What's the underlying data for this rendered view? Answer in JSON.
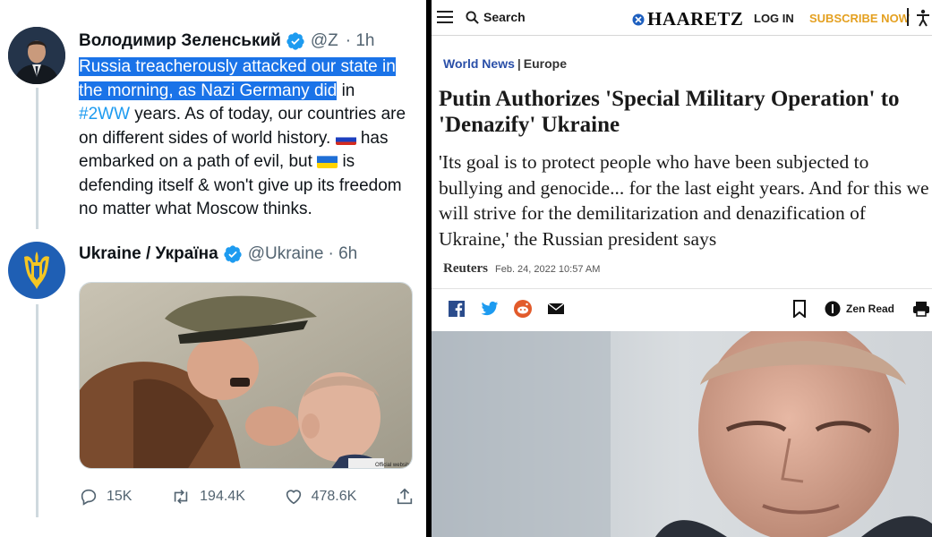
{
  "left": {
    "tweet1": {
      "name": "Володимир Зеленський",
      "handle": "@Z",
      "time": "· 1h",
      "text_highlight_1": "Russia treacherously attacked our state in",
      "text_highlight_2": "the morning, as Nazi Germany did",
      "text_after_highlight": " in",
      "hashtag": "#2WW",
      "text_2": " years. As of today, our countries are on different sides of world history. ",
      "text_3": " has embarked on a path of evil, but ",
      "text_4": " is defending itself & won't give up its freedom no matter what Moscow thinks."
    },
    "tweet2": {
      "name": "Ukraine / Україна",
      "handle": "@Ukraine",
      "time": "· 6h",
      "image_caption": "Official website",
      "replies": "15K",
      "retweets": "194.4K",
      "likes": "478.6K"
    },
    "colors": {
      "verified": "#1d9bf0",
      "highlight": "#1a73e8",
      "link": "#1d9bf0"
    }
  },
  "right": {
    "topbar": {
      "search_label": "Search",
      "logo": "HAARETZ",
      "login": "LOG IN",
      "subscribe": "SUBSCRIBE NOW"
    },
    "breadcrumb": {
      "section": "World News",
      "subsection": "Europe"
    },
    "headline": "Putin Authorizes 'Special Military Operation' to 'Denazify' Ukraine",
    "subhead": "'Its goal is to protect people who have been subjected to bullying and genocide... for the last eight years. And for this we will strive for the demilitarization and denazification of Ukraine,' the Russian president says",
    "byline": {
      "source": "Reuters",
      "date": "Feb. 24, 2022 10:57 AM"
    },
    "tools": {
      "zen_read": "Zen Read"
    },
    "colors": {
      "subscribe": "#e4a020",
      "breadcrumb": "#2a4fa8"
    }
  }
}
